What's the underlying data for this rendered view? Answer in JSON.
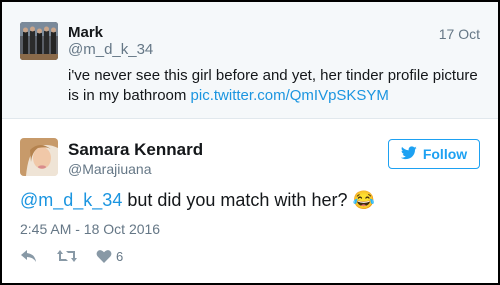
{
  "quoted_tweet": {
    "name": "Mark",
    "handle": "@m_d_k_34",
    "date": "17 Oct",
    "text": "i've never see this girl before and yet, her tinder profile picture is in my bathroom ",
    "link": "pic.twitter.com/QmIVpSKSYM"
  },
  "tweet": {
    "name": "Samara Kennard",
    "handle": "@Marajiuana",
    "follow_label": "Follow",
    "mention": "@m_d_k_34",
    "text": " but did you match with her? ",
    "emoji": "😂",
    "timestamp": "2:45 AM - 18 Oct 2016",
    "like_count": "6"
  },
  "colors": {
    "accent": "#1da1f2",
    "link": "#1b95e0",
    "muted": "#657786"
  }
}
